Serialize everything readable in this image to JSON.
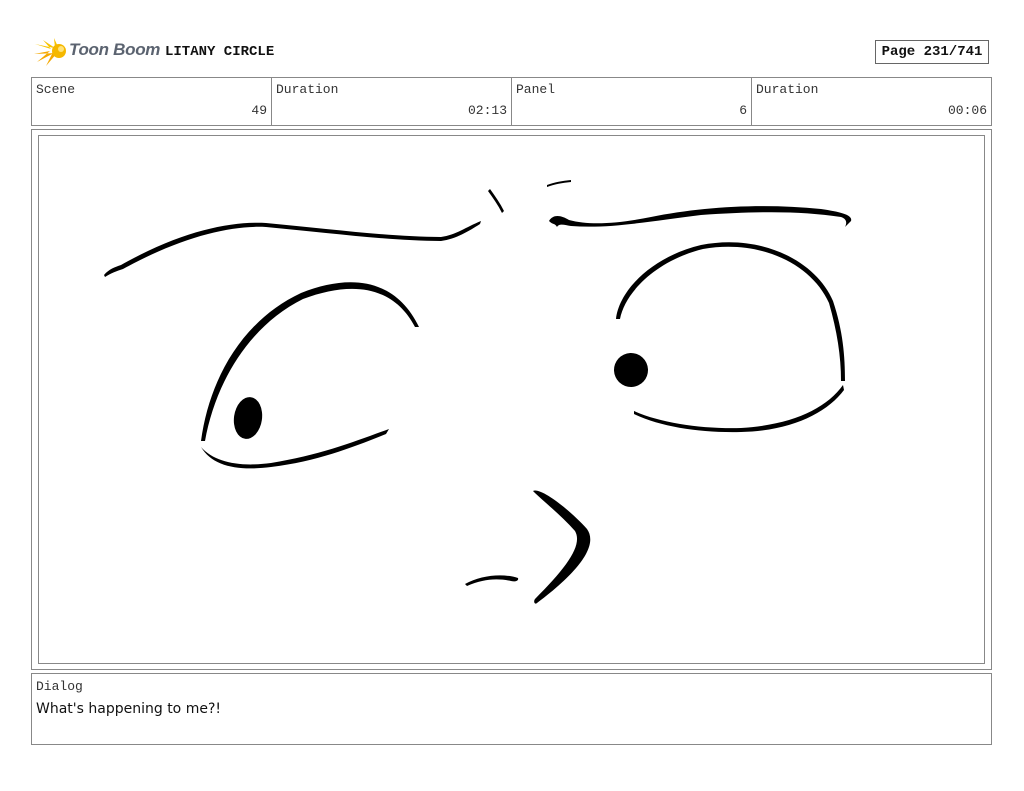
{
  "header": {
    "logo_text": "Toon Boom",
    "project_title": "LITANY CIRCLE",
    "page_label": "Page 231/741"
  },
  "info": {
    "scene_label": "Scene",
    "scene_value": "49",
    "scene_duration_label": "Duration",
    "scene_duration_value": "02:13",
    "panel_label": "Panel",
    "panel_value": "6",
    "panel_duration_label": "Duration",
    "panel_duration_value": "00:06"
  },
  "dialog": {
    "label": "Dialog",
    "text": "What's happening to me?!"
  },
  "colors": {
    "logo_star": "#f5b800",
    "logo_text": "#5b6370",
    "border": "#888888",
    "ink": "#000000"
  },
  "icons": {
    "logo": "toon-boom-star-logo"
  }
}
